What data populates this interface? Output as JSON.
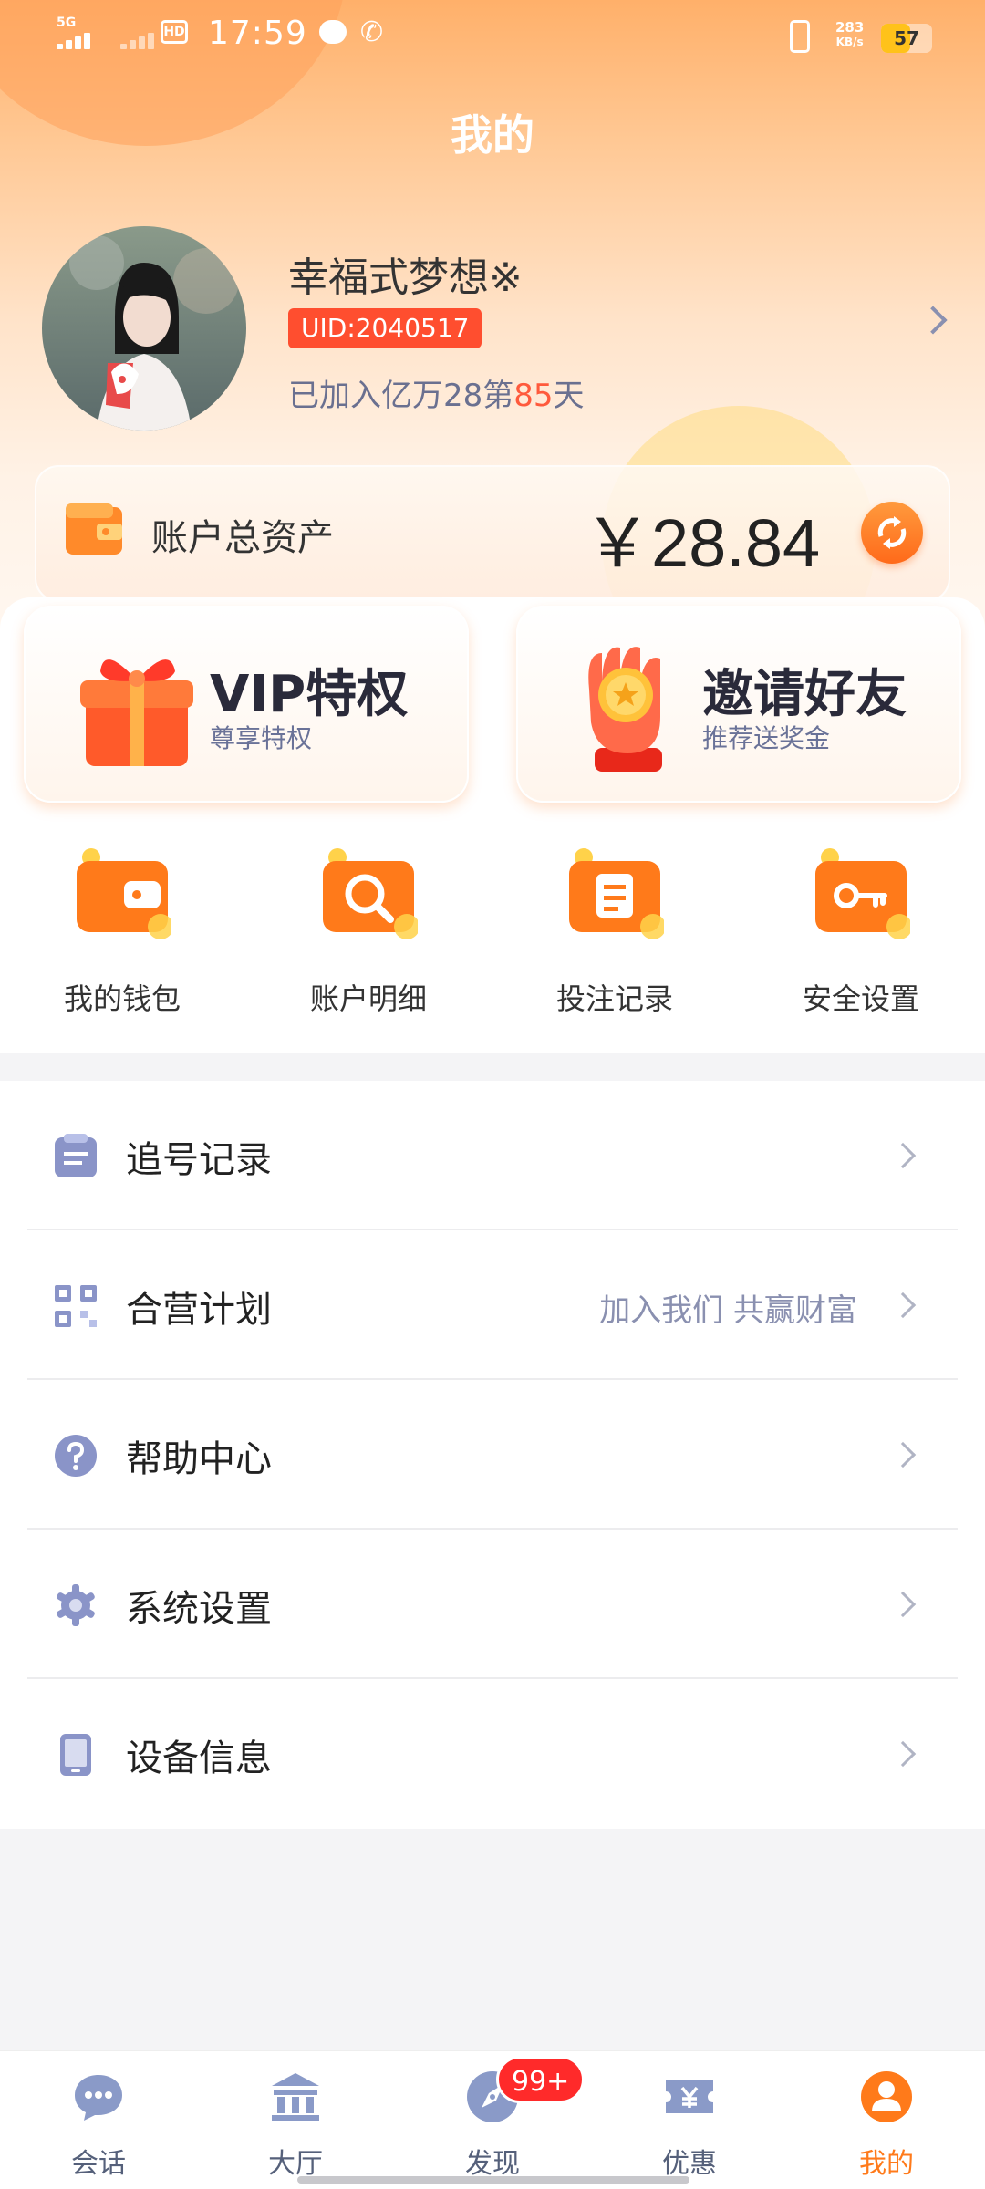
{
  "status_bar": {
    "network": "5G",
    "time": "17:59",
    "hd": "HD",
    "speed_value": "283",
    "speed_unit": "KB/s",
    "battery": "57",
    "battery_level": 0.57
  },
  "header": {
    "title": "我的"
  },
  "profile": {
    "username": "幸福式梦想※",
    "uid": "UID:2040517",
    "joined_prefix": "已加入亿万28第",
    "joined_days": "85",
    "joined_suffix": "天"
  },
  "assets": {
    "label": "账户总资产",
    "value": "￥28.84"
  },
  "promos": [
    {
      "title": "VIP特权",
      "subtitle": "尊享特权"
    },
    {
      "title": "邀请好友",
      "subtitle": "推荐送奖金"
    }
  ],
  "quick_actions": [
    {
      "label": "我的钱包",
      "icon": "wallet-icon"
    },
    {
      "label": "账户明细",
      "icon": "magnifier-icon"
    },
    {
      "label": "投注记录",
      "icon": "clipboard-icon"
    },
    {
      "label": "安全设置",
      "icon": "key-icon"
    }
  ],
  "menu": [
    {
      "label": "追号记录",
      "hint": "",
      "icon": "document-icon"
    },
    {
      "label": "合营计划",
      "hint": "加入我们 共赢财富",
      "icon": "qr-grid-icon"
    },
    {
      "label": "帮助中心",
      "hint": "",
      "icon": "help-icon"
    },
    {
      "label": "系统设置",
      "hint": "",
      "icon": "gear-icon"
    },
    {
      "label": "设备信息",
      "hint": "",
      "icon": "device-icon"
    }
  ],
  "tabs": [
    {
      "label": "会话",
      "icon": "chat-icon"
    },
    {
      "label": "大厅",
      "icon": "hall-icon"
    },
    {
      "label": "发现",
      "icon": "compass-icon",
      "badge": "99+"
    },
    {
      "label": "优惠",
      "icon": "coupon-icon"
    },
    {
      "label": "我的",
      "icon": "profile-icon",
      "active": true
    }
  ],
  "colors": {
    "accent": "#ff7a1a",
    "badge": "#ff2a2a",
    "uid_bg": "#ff4e2f"
  }
}
